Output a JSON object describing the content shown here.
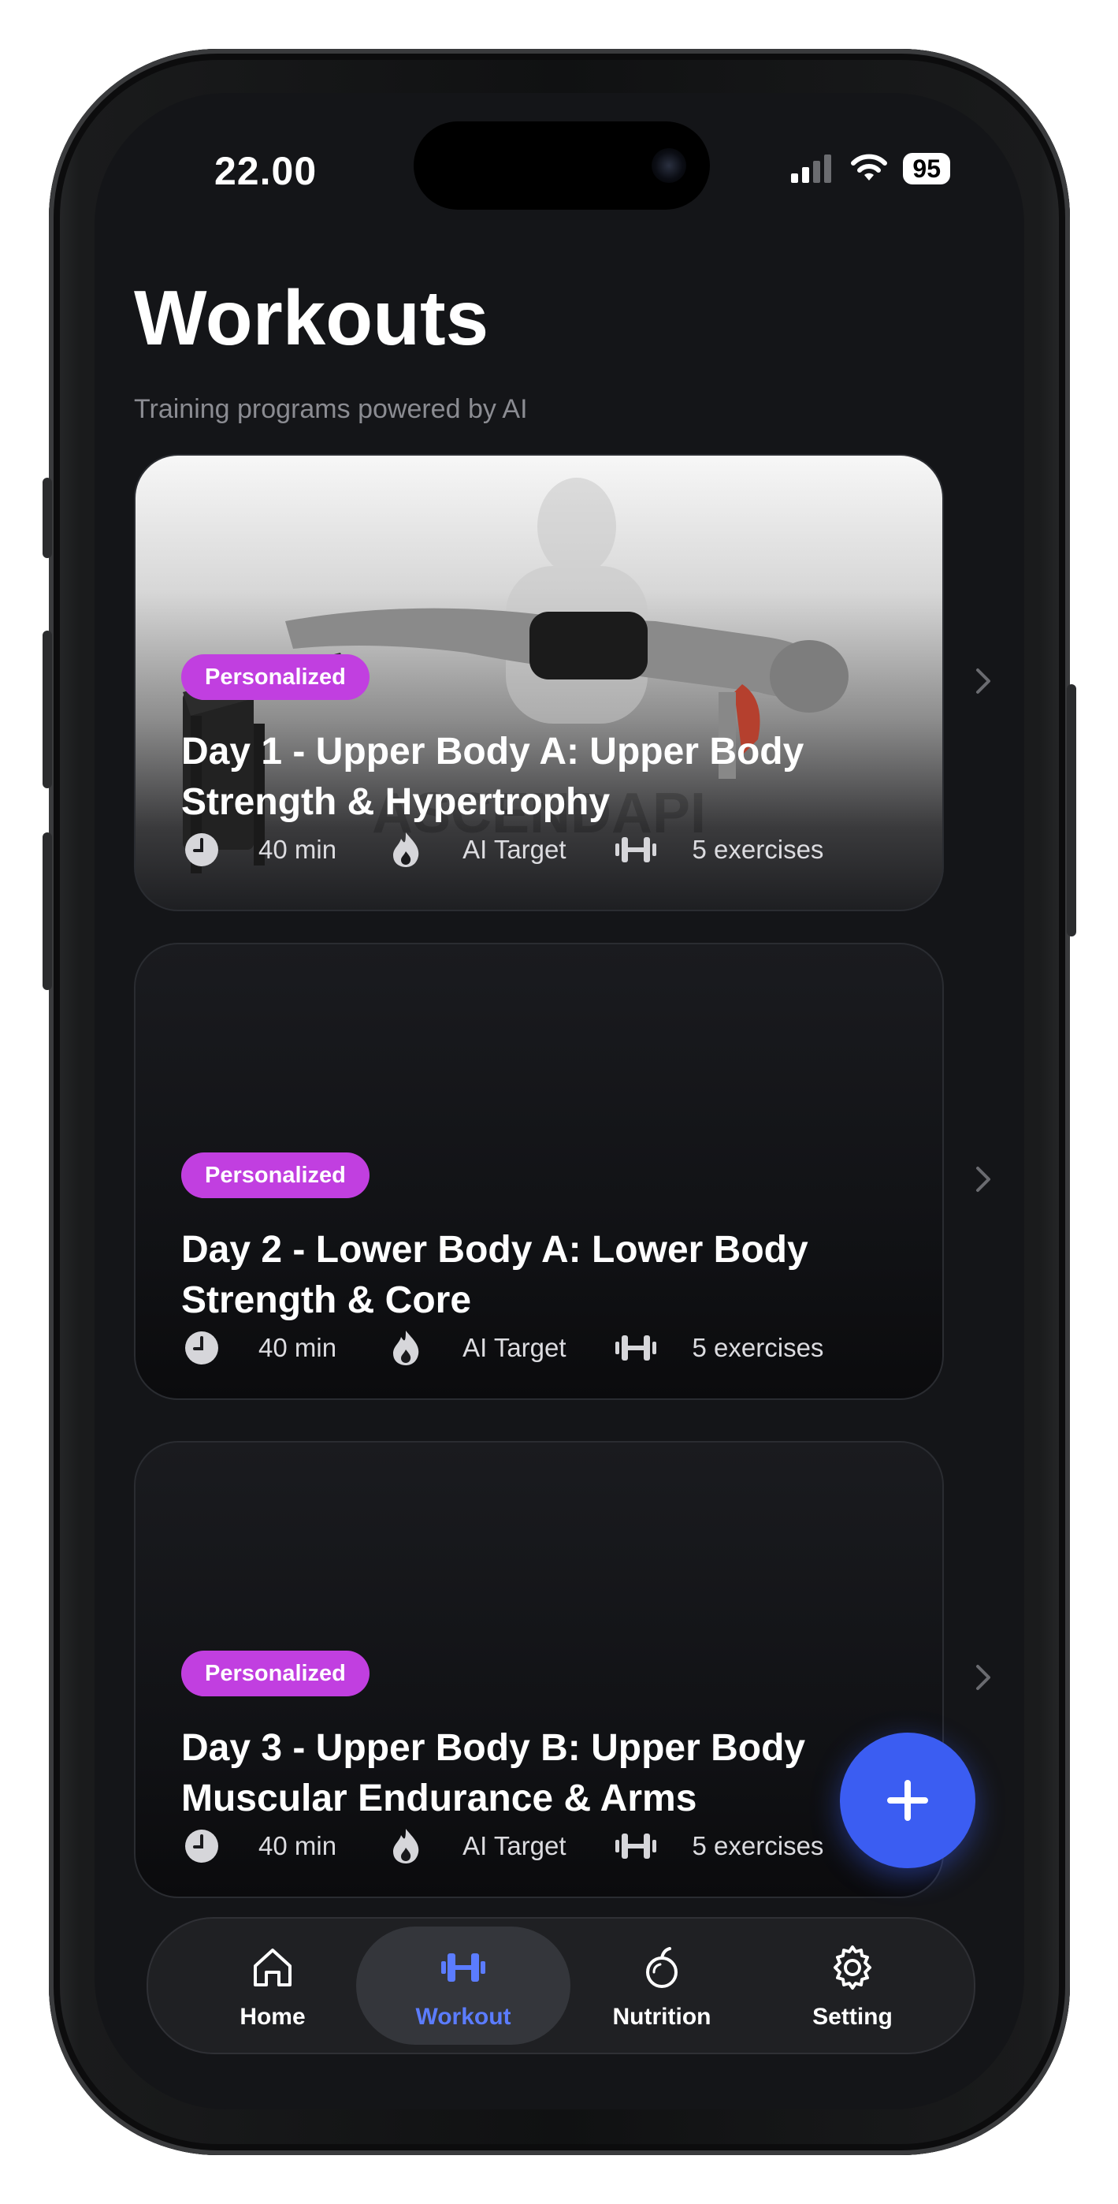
{
  "status_bar": {
    "time": "22.00",
    "battery": "95"
  },
  "header": {
    "title": "Workouts",
    "subtitle": "Training programs powered by AI"
  },
  "workouts": [
    {
      "badge": "Personalized",
      "title": "Day 1 - Upper Body A: Upper Body Strength & Hypertrophy",
      "duration": "40 min",
      "target": "AI Target",
      "exercises": "5 exercises",
      "image_watermark": "ASCENDAPI"
    },
    {
      "badge": "Personalized",
      "title": "Day 2 - Lower Body A: Lower Body Strength & Core",
      "duration": "40 min",
      "target": "AI Target",
      "exercises": "5 exercises"
    },
    {
      "badge": "Personalized",
      "title": "Day 3 - Upper Body B: Upper Body Muscular Endurance & Arms",
      "duration": "40 min",
      "target": "AI Target",
      "exercises": "5 exercises"
    }
  ],
  "tabbar": {
    "home": "Home",
    "workout": "Workout",
    "nutrition": "Nutrition",
    "setting": "Setting",
    "active": "workout"
  },
  "colors": {
    "accent": "#3b5df2",
    "badge": "#c13fe0",
    "active_tab_label": "#5b7cff",
    "background": "#141518"
  },
  "icons": [
    "clock-icon",
    "flame-icon",
    "dumbbell-icon",
    "chevron-right-icon",
    "plus-icon",
    "home-icon",
    "workout-icon",
    "apple-icon",
    "gear-icon"
  ]
}
